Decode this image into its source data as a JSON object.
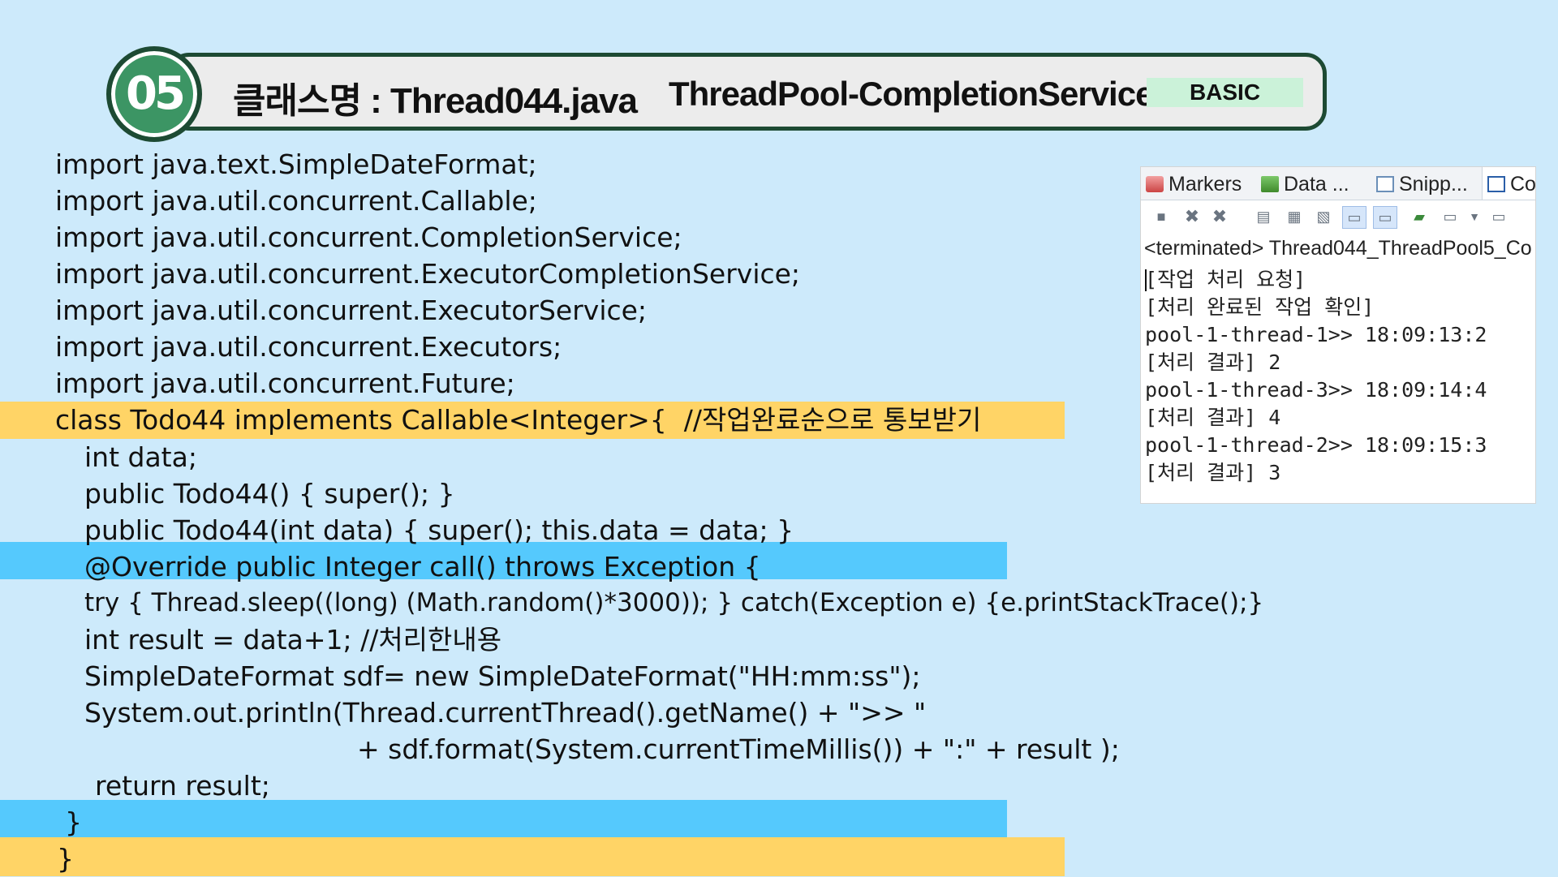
{
  "header": {
    "number": "05",
    "class_label": "클래스명 : Thread044.java",
    "topic": "ThreadPool-CompletionService",
    "level": "BASIC"
  },
  "code_lines": [
    "import java.text.SimpleDateFormat;",
    "import java.util.concurrent.Callable;",
    "import java.util.concurrent.CompletionService;",
    "import java.util.concurrent.ExecutorCompletionService;",
    "import java.util.concurrent.ExecutorService;",
    "import java.util.concurrent.Executors;",
    "import java.util.concurrent.Future;",
    "class Todo44 implements Callable<Integer>{  //작업완료순으로 통보받기",
    "int data;",
    "public Todo44() { super(); }",
    "public Todo44(int data) { super(); this.data = data; }",
    "@Override public Integer call() throws Exception {",
    "try { Thread.sleep((long) (Math.random()*3000)); } catch(Exception e) {e.printStackTrace();}",
    "int result = data+1; //처리한내용",
    "SimpleDateFormat sdf= new SimpleDateFormat(\"HH:mm:ss\");",
    "System.out.println(Thread.currentThread().getName() + \">> \"",
    "+ sdf.format(System.currentTimeMillis()) + \":\" + result );",
    "return result;",
    "}",
    "}"
  ],
  "console": {
    "tabs": [
      "Markers",
      "Data ...",
      "Snipp...",
      "Co"
    ],
    "active_tab": "Co",
    "status": "<terminated> Thread044_ThreadPool5_Co",
    "output": [
      "[작업 처리 요청]",
      "[처리 완료된 작업 확인]",
      "pool-1-thread-1>> 18:09:13:2",
      "[처리 결과] 2",
      "pool-1-thread-3>> 18:09:14:4",
      "[처리 결과] 4",
      "pool-1-thread-2>> 18:09:15:3",
      "[처리 결과] 3"
    ],
    "toolbar_icons": [
      "terminate-icon",
      "remove-launch-icon",
      "remove-all-terminated-icon",
      "clear-console-icon",
      "scroll-lock-icon",
      "word-wrap-icon",
      "show-on-stdout-icon",
      "show-on-stderr-icon",
      "pin-console-icon",
      "display-selected-console-icon",
      "view-menu-icon",
      "open-console-icon"
    ]
  },
  "colors": {
    "background": "#cdeafb",
    "class_highlight": "#ffd466",
    "method_highlight": "#55c9fd",
    "badge": "#3c9564",
    "header_border": "#1d4a33",
    "level_badge": "#cbf2d9"
  }
}
